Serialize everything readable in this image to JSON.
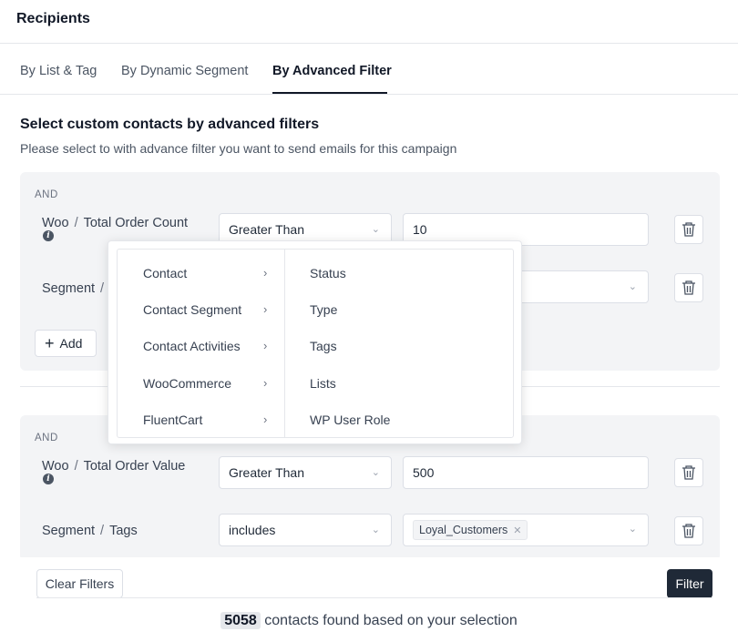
{
  "header": {
    "title": "Recipients"
  },
  "tabs": [
    {
      "label": "By List & Tag",
      "active": false
    },
    {
      "label": "By Dynamic Segment",
      "active": false
    },
    {
      "label": "By Advanced Filter",
      "active": true
    }
  ],
  "section": {
    "title": "Select custom contacts by advanced filters",
    "description": "Please select to with advance filter you want to send emails for this campaign"
  },
  "groups": [
    {
      "label": "AND",
      "rows": [
        {
          "category": "Woo",
          "field": "Total Order Count",
          "has_info": true,
          "operator": "Greater Than",
          "value": "10"
        },
        {
          "category": "Segment",
          "field": "",
          "operator": "",
          "value": ""
        }
      ],
      "add_label": "Add"
    },
    {
      "label": "AND",
      "rows": [
        {
          "category": "Woo",
          "field": "Total Order Value",
          "has_info": true,
          "operator": "Greater Than",
          "value": "500"
        },
        {
          "category": "Segment",
          "field": "Tags",
          "operator": "includes",
          "tag": "Loyal_Customers"
        }
      ]
    }
  ],
  "popover": {
    "categories": [
      "Contact",
      "Contact Segment",
      "Contact Activities",
      "WooCommerce",
      "FluentCart"
    ],
    "fields": [
      "Status",
      "Type",
      "Tags",
      "Lists",
      "WP User Role"
    ]
  },
  "footer": {
    "clear_label": "Clear Filters",
    "filter_label": "Filter",
    "count": "5058",
    "result_text": "contacts found based on your selection"
  },
  "colors": {
    "primary_dark": "#1f2937",
    "panel_bg": "#f3f4f6",
    "border": "#dcdfe6"
  }
}
